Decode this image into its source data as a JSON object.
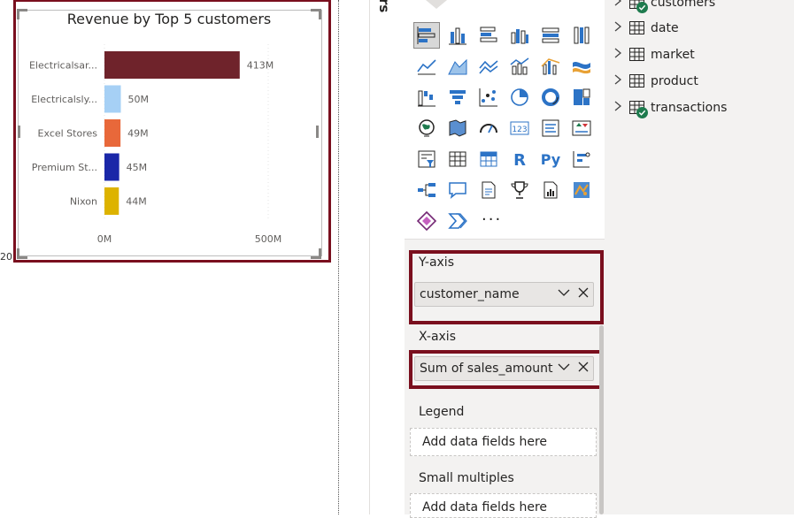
{
  "chart": {
    "title": "Revenue by Top 5 customers",
    "cut_label": "20",
    "bar_color_default": "#6f232b"
  },
  "chart_data": {
    "type": "bar",
    "orientation": "horizontal",
    "title": "Revenue by Top 5 customers",
    "categories": [
      "Electricalsar...",
      "Electricalsly...",
      "Excel Stores",
      "Premium St...",
      "Nixon"
    ],
    "values": [
      413,
      50,
      49,
      45,
      44
    ],
    "value_labels": [
      "413M",
      "50M",
      "49M",
      "45M",
      "44M"
    ],
    "colors": [
      "#6f232b",
      "#a6d0f5",
      "#e8683a",
      "#1a27a8",
      "#ddb300"
    ],
    "x_ticks": [
      "0M",
      "500M"
    ],
    "x_tick_values": [
      0,
      500
    ],
    "xlim": [
      0,
      500
    ],
    "unit": "M",
    "grid": true,
    "legend": false
  },
  "strip": {
    "label": "rs"
  },
  "visualizations": {
    "icons": [
      [
        "stacked-bar-icon",
        "stacked-column-icon",
        "clustered-bar-icon",
        "clustered-column-icon",
        "100-stacked-bar-icon",
        "100-stacked-column-icon"
      ],
      [
        "line-chart-icon",
        "area-chart-icon",
        "stacked-area-icon",
        "line-stacked-column-icon",
        "line-clustered-column-icon",
        "ribbon-chart-icon"
      ],
      [
        "waterfall-icon",
        "funnel-icon",
        "scatter-icon",
        "pie-icon",
        "donut-icon",
        "treemap-icon"
      ],
      [
        "map-icon",
        "filled-map-icon",
        "gauge-icon",
        "card-icon",
        "multi-row-card-icon",
        "kpi-icon"
      ],
      [
        "slicer-icon",
        "table-icon",
        "matrix-icon",
        "r-visual-icon",
        "python-visual-icon",
        "key-influencers-icon"
      ],
      [
        "decomposition-tree-icon",
        "qa-icon",
        "smart-narrative-icon",
        "trophy-goals-icon",
        "paginated-report-icon",
        "arcgis-map-icon"
      ],
      [
        "power-apps-icon",
        "power-automate-icon",
        "more-visuals-icon"
      ]
    ],
    "more_label": "···",
    "wells": {
      "y_axis": {
        "label": "Y-axis",
        "field": "customer_name"
      },
      "x_axis": {
        "label": "X-axis",
        "field": "Sum of sales_amount"
      },
      "legend": {
        "label": "Legend",
        "placeholder": "Add data fields here"
      },
      "small_multiples": {
        "label": "Small multiples",
        "placeholder": "Add data fields here"
      }
    }
  },
  "fields": {
    "tables": [
      {
        "name": "customers",
        "checked": true
      },
      {
        "name": "date",
        "checked": false
      },
      {
        "name": "market",
        "checked": false
      },
      {
        "name": "product",
        "checked": false
      },
      {
        "name": "transactions",
        "checked": true
      }
    ]
  }
}
